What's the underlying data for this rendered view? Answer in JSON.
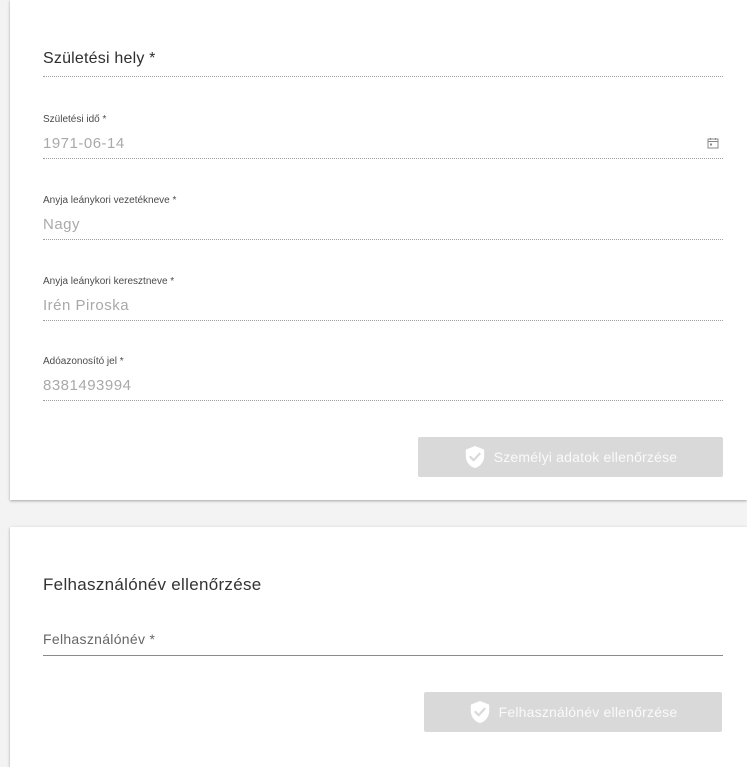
{
  "personal_card": {
    "birth_place": {
      "label": "Születési hely *"
    },
    "birth_date": {
      "label": "Születési idő *",
      "value": "1971-06-14",
      "icon": "calendar-icon"
    },
    "mother_surname": {
      "label": "Anyja leánykori vezetékneve *",
      "value": "Nagy"
    },
    "mother_firstname": {
      "label": "Anyja leánykori keresztneve *",
      "value": "Irén Piroska"
    },
    "tax_id": {
      "label": "Adóazonosító jel *",
      "value": "8381493994"
    },
    "verify_button": {
      "label": "Személyi adatok ellenőrzése",
      "icon": "shield-check-icon"
    }
  },
  "username_card": {
    "title": "Felhasználónév ellenőrzése",
    "username": {
      "placeholder": "Felhasználónév *"
    },
    "verify_button": {
      "label": "Felhasználónév ellenőrzése",
      "icon": "shield-check-icon"
    }
  },
  "colors": {
    "button_disabled_bg": "#d9d9d9",
    "button_text": "#fafafa",
    "card_bg": "#ffffff",
    "page_bg": "#f3f3f3"
  }
}
